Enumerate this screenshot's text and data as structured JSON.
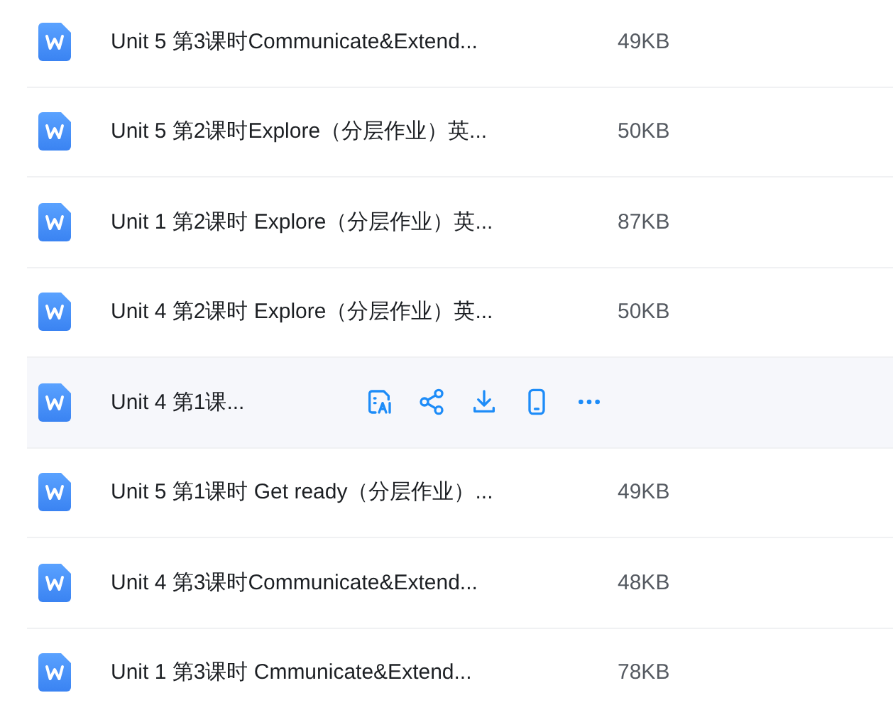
{
  "files": [
    {
      "name": "Unit 5 第3课时Communicate&Extend...",
      "size": "49KB",
      "hovered": false
    },
    {
      "name": "Unit 5 第2课时Explore（分层作业）英...",
      "size": "50KB",
      "hovered": false
    },
    {
      "name": "Unit 1 第2课时 Explore（分层作业）英...",
      "size": "87KB",
      "hovered": false
    },
    {
      "name": "Unit 4 第2课时 Explore（分层作业）英...",
      "size": "50KB",
      "hovered": false
    },
    {
      "name": "Unit 4 第1课...",
      "hovered": true
    },
    {
      "name": "Unit 5 第1课时 Get ready（分层作业）...",
      "size": "49KB",
      "hovered": false
    },
    {
      "name": "Unit 4 第3课时Communicate&Extend...",
      "size": "48KB",
      "hovered": false
    },
    {
      "name": "Unit 1 第3课时 Cmmunicate&Extend...",
      "size": "78KB",
      "hovered": false
    }
  ]
}
